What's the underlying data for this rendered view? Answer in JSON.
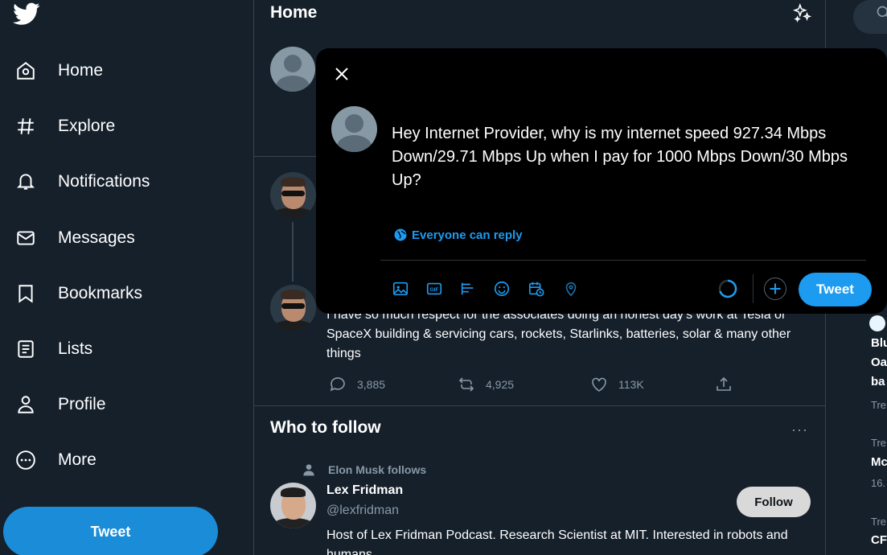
{
  "colors": {
    "background": "#15202b",
    "accent": "#1d9bf0",
    "modal": "#000000",
    "muted": "#8899a6",
    "border": "#38444d"
  },
  "sidebar": {
    "logo_icon": "twitter-bird-icon",
    "items": [
      {
        "label": "Home",
        "icon": "home-icon"
      },
      {
        "label": "Explore",
        "icon": "hashtag-icon"
      },
      {
        "label": "Notifications",
        "icon": "bell-icon"
      },
      {
        "label": "Messages",
        "icon": "envelope-icon"
      },
      {
        "label": "Bookmarks",
        "icon": "bookmark-icon"
      },
      {
        "label": "Lists",
        "icon": "list-icon"
      },
      {
        "label": "Profile",
        "icon": "person-icon"
      },
      {
        "label": "More",
        "icon": "more-circle-icon"
      }
    ],
    "tweet_button": "Tweet"
  },
  "main": {
    "title": "Home",
    "tweet": {
      "text": "I have so much respect for the associates doing an honest day’s work at Tesla or SpaceX building & servicing cars, rockets, Starlinks, batteries, solar & many other things",
      "replies": "3,885",
      "retweets": "4,925",
      "likes": "113K"
    },
    "who_to_follow": {
      "title": "Who to follow",
      "more": "···",
      "context": "Elon Musk follows",
      "name": "Lex Fridman",
      "handle": "@lexfridman",
      "bio": "Host of Lex Fridman Podcast. Research Scientist at MIT. Interested in robots and humans.",
      "follow_button": "Follow"
    }
  },
  "right": {
    "lines": [
      "Blu",
      "Oa",
      "ba",
      "Tre",
      "Tre",
      "Mc",
      "16.",
      "Tre",
      "CF"
    ]
  },
  "compose": {
    "text": "Hey Internet Provider, why is my internet speed 927.34 Mbps Down/29.71 Mbps Up when I pay for 1000 Mbps Down/30 Mbps Up?",
    "reply_setting": "Everyone can reply",
    "tweet_button": "Tweet",
    "tools": [
      "image-icon",
      "gif-icon",
      "poll-icon",
      "emoji-icon",
      "schedule-icon",
      "location-icon"
    ]
  }
}
